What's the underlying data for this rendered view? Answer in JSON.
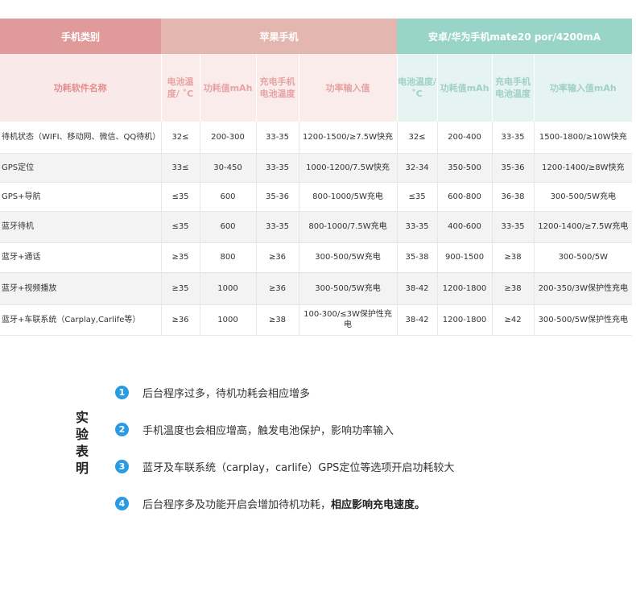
{
  "table": {
    "group_headers": {
      "type": "手机类别",
      "apple": "苹果手机",
      "android": "安卓/华为手机mate20 por/4200mA"
    },
    "sub_headers": {
      "name": "功耗软件名称",
      "apple_temp": "电池温度/ ˚C",
      "apple_power": "功耗值mAh",
      "apple_charge_temp": "充电手机电池温度",
      "apple_input": "功率输入值",
      "android_temp": "电池温度/ ˚C",
      "android_power": "功耗值mAh",
      "android_charge_temp": "充电手机电池温度",
      "android_input": "功率输入值mAh"
    },
    "rows": [
      {
        "name": "待机状态（WIFI、移动网、微信、QQ待机）",
        "a_temp": "32≤",
        "a_power": "200-300",
        "a_ctemp": "33-35",
        "a_input": "1200-1500/≥7.5W快充",
        "b_temp": "32≤",
        "b_power": "200-400",
        "b_ctemp": "33-35",
        "b_input": "1500-1800/≥10W快充"
      },
      {
        "name": "GPS定位",
        "a_temp": "33≤",
        "a_power": "30-450",
        "a_ctemp": "33-35",
        "a_input": "1000-1200/7.5W快充",
        "b_temp": "32-34",
        "b_power": "350-500",
        "b_ctemp": "35-36",
        "b_input": "1200-1400/≥8W快充"
      },
      {
        "name": "GPS+导航",
        "a_temp": "≤35",
        "a_power": "600",
        "a_ctemp": "35-36",
        "a_input": "800-1000/5W充电",
        "b_temp": "≤35",
        "b_power": "600-800",
        "b_ctemp": "36-38",
        "b_input": "300-500/5W充电"
      },
      {
        "name": "蓝牙待机",
        "a_temp": "≤35",
        "a_power": "600",
        "a_ctemp": "33-35",
        "a_input": "800-1000/7.5W充电",
        "b_temp": "33-35",
        "b_power": "400-600",
        "b_ctemp": "33-35",
        "b_input": "1200-1400/≥7.5W充电"
      },
      {
        "name": "蓝牙+通话",
        "a_temp": "≥35",
        "a_power": "800",
        "a_ctemp": "≥36",
        "a_input": "300-500/5W充电",
        "b_temp": "35-38",
        "b_power": "900-1500",
        "b_ctemp": "≥38",
        "b_input": "300-500/5W"
      },
      {
        "name": "蓝牙+视频播放",
        "a_temp": "≥35",
        "a_power": "1000",
        "a_ctemp": "≥36",
        "a_input": "300-500/5W充电",
        "b_temp": "38-42",
        "b_power": "1200-1800",
        "b_ctemp": "≥38",
        "b_input": "200-350/3W保护性充电"
      },
      {
        "name": "蓝牙+车联系统（Carplay,Carlife等）",
        "a_temp": "≥36",
        "a_power": "1000",
        "a_ctemp": "≥38",
        "a_input": "100-300/≤3W保护性充电",
        "b_temp": "38-42",
        "b_power": "1200-1800",
        "b_ctemp": "≥42",
        "b_input": "300-500/5W保护性充电"
      }
    ]
  },
  "conclusion": {
    "label": "实验表明",
    "items": [
      {
        "number": "1",
        "text": "后台程序过多，待机功耗会相应增多",
        "bold": ""
      },
      {
        "number": "2",
        "text": "手机温度也会相应增高，触发电池保护，影响功率输入",
        "bold": ""
      },
      {
        "number": "3",
        "text": "蓝牙及车联系统（carplay，carlife）GPS定位等选项开启功耗较大",
        "bold": ""
      },
      {
        "number": "4",
        "text": "后台程序多及功能开启会增加待机功耗，",
        "bold": "相应影响充电速度。"
      }
    ]
  },
  "colors": {
    "type_header": "#e09a9a",
    "apple_header": "#e3b6b0",
    "android_header": "#98d4c8",
    "badge": "#2a9be0"
  }
}
